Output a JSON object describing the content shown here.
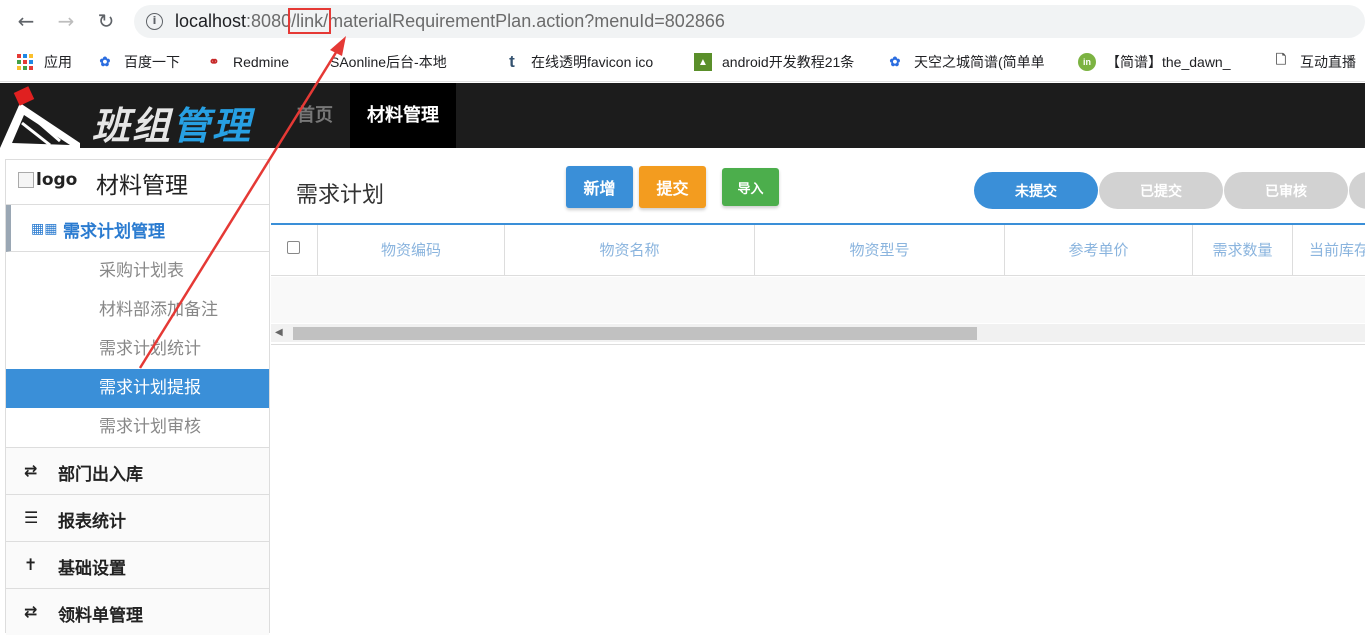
{
  "browser": {
    "url_host": "localhost",
    "url_port": ":8080",
    "url_highlight": "/link/",
    "url_rest": "materialRequirementPlan.action?menuId=802866",
    "bookmarks": [
      {
        "label": "应用",
        "icon": "apps-grid-icon"
      },
      {
        "label": "百度一下",
        "icon": "baidu-paw-icon"
      },
      {
        "label": "Redmine",
        "icon": "redmine-icon"
      },
      {
        "label": "SAonline后台-本地",
        "icon": "page-icon"
      },
      {
        "label": "在线透明favicon ico",
        "icon": "tumblr-icon"
      },
      {
        "label": "android开发教程21条",
        "icon": "image-icon"
      },
      {
        "label": "天空之城简谱(简单单",
        "icon": "baidu-paw-icon"
      },
      {
        "label": "【简谱】the_dawn_",
        "icon": "green-leaf-icon"
      },
      {
        "label": "互动直播",
        "icon": "page-icon"
      }
    ]
  },
  "header": {
    "brand_part1": "班组",
    "brand_part2": "管理",
    "nav": [
      {
        "label": "首页",
        "active": false
      },
      {
        "label": "材料管理",
        "active": true
      }
    ]
  },
  "sidebar": {
    "logo_alt": "logo",
    "title": "材料管理",
    "group": {
      "label": "需求计划管理",
      "icon": "grid-icon"
    },
    "subitems": [
      {
        "label": "采购计划表",
        "active": false
      },
      {
        "label": "材料部添加备注",
        "active": false
      },
      {
        "label": "需求计划统计",
        "active": false
      },
      {
        "label": "需求计划提报",
        "active": true
      },
      {
        "label": "需求计划审核",
        "active": false
      }
    ],
    "sections": [
      {
        "label": "部门出入库",
        "icon": "transfer-icon"
      },
      {
        "label": "报表统计",
        "icon": "list-icon"
      },
      {
        "label": "基础设置",
        "icon": "person-icon"
      },
      {
        "label": "领料单管理",
        "icon": "transfer-icon"
      }
    ]
  },
  "main": {
    "title": "需求计划",
    "buttons": {
      "add": "新增",
      "submit": "提交",
      "import": "导入"
    },
    "status_tabs": [
      "未提交",
      "已提交",
      "已审核",
      ""
    ],
    "table_columns": [
      "物资编码",
      "物资名称",
      "物资型号",
      "参考单价",
      "需求数量",
      "当前库存"
    ]
  },
  "colors": {
    "accent_blue": "#3a8fd8",
    "orange": "#f39c1f",
    "green": "#4cae4c",
    "header_bg": "#1c1c1c",
    "annotation_red": "#e53935"
  }
}
